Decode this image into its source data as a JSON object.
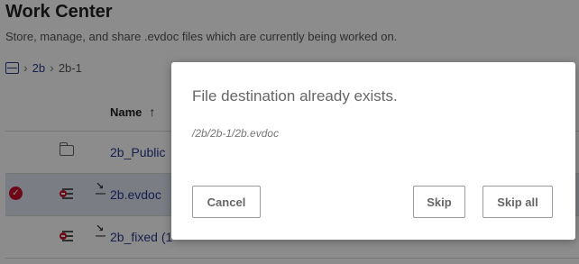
{
  "page": {
    "title": "Work Center",
    "subtitle": "Store, manage, and share .evdoc files which are currently being worked on."
  },
  "breadcrumb": {
    "items": [
      "2b",
      "2b-1"
    ]
  },
  "table": {
    "header_name": "Name",
    "sort_arrow": "↑",
    "rows": [
      {
        "name": "2b_Public",
        "type": "folder",
        "selected": false
      },
      {
        "name": "2b.evdoc",
        "type": "evdoc",
        "selected": true
      },
      {
        "name": "2b_fixed (1",
        "type": "evdoc",
        "selected": false
      }
    ]
  },
  "dialog": {
    "title": "File destination already exists.",
    "path": "/2b/2b-1/2b.evdoc",
    "buttons": {
      "cancel": "Cancel",
      "skip": "Skip",
      "skip_all": "Skip all"
    }
  },
  "icons": {
    "home": "drive-icon",
    "check": "check-circle-icon",
    "folder": "folder-icon",
    "doc": "evdoc-file-icon",
    "edit": "editing-icon"
  },
  "colors": {
    "link": "#2b3a8c",
    "selection": "#dfe3ee",
    "check": "#c8102e"
  }
}
